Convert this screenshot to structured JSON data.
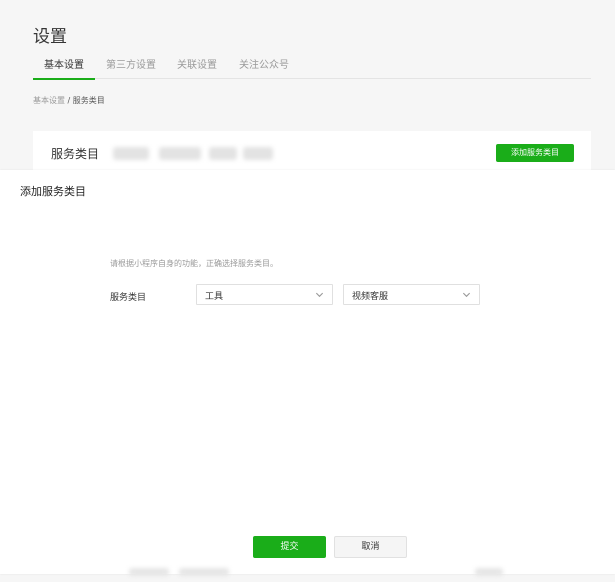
{
  "page": {
    "title": "设置",
    "tabs": [
      {
        "label": "基本设置",
        "active": true
      },
      {
        "label": "第三方设置",
        "active": false
      },
      {
        "label": "关联设置",
        "active": false
      },
      {
        "label": "关注公众号",
        "active": false
      }
    ],
    "breadcrumb": {
      "parent": "基本设置",
      "separator": " / ",
      "current": "服务类目"
    },
    "service_card": {
      "title": "服务类目",
      "add_button": "添加服务类目"
    }
  },
  "modal": {
    "title": "添加服务类目",
    "hint": "请根据小程序自身的功能，正确选择服务类目。",
    "form": {
      "label": "服务类目",
      "primary_select": {
        "value": "工具",
        "icon": "chevron-down-icon"
      },
      "secondary_select": {
        "value": "视频客服",
        "icon": "chevron-down-icon"
      }
    },
    "submit_label": "提交",
    "cancel_label": "取消"
  },
  "colors": {
    "accent": "#1aad19",
    "background": "#f6f6f6"
  }
}
